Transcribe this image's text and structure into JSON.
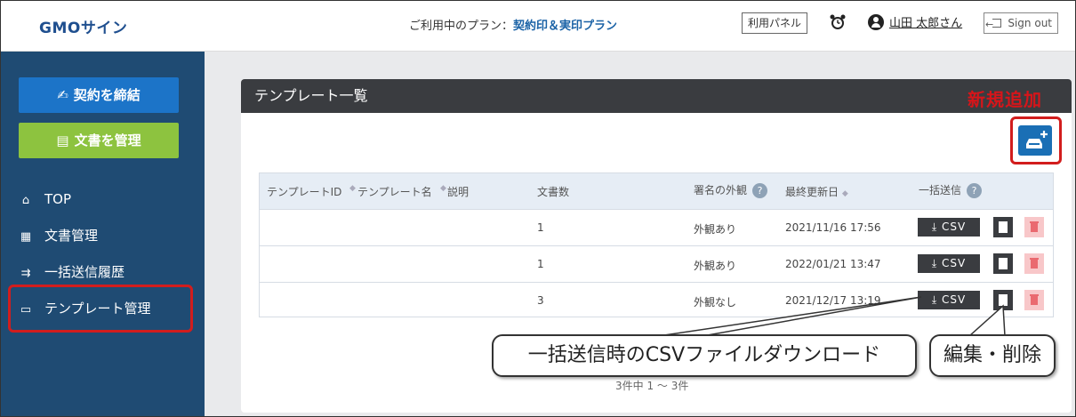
{
  "header": {
    "logo": "GMOサイン",
    "plan_label": "ご利用中のプラン：",
    "plan_name": "契約印＆実印プラン",
    "panel_button": "利用パネル",
    "user_name": "山田 太郎さん",
    "signout": "Sign out"
  },
  "sidebar": {
    "contract_button": "契約を締結",
    "docs_button": "文書を管理",
    "items": [
      {
        "label": "TOP",
        "icon": "home-icon"
      },
      {
        "label": "文書管理",
        "icon": "table-icon"
      },
      {
        "label": "一括送信履歴",
        "icon": "bulk-send-icon"
      },
      {
        "label": "テンプレート管理",
        "icon": "inbox-icon"
      }
    ]
  },
  "main": {
    "title": "テンプレート一覧",
    "new_label": "新規追加",
    "table": {
      "headers": [
        "テンプレートID",
        "テンプレート名",
        "説明",
        "文書数",
        "署名の外観",
        "最終更新日",
        "一括送信"
      ],
      "rows": [
        {
          "count": "1",
          "appearance": "外観あり",
          "updated": "2021/11/16 17:56",
          "csv": "CSV"
        },
        {
          "count": "1",
          "appearance": "外観あり",
          "updated": "2022/01/21 13:47",
          "csv": "CSV"
        },
        {
          "count": "3",
          "appearance": "外観なし",
          "updated": "2021/12/17 13:19",
          "csv": "CSV"
        }
      ]
    },
    "pager": "3件中 1 〜 3件"
  },
  "callouts": {
    "csv": "一括送信時のCSVファイルダウンロード",
    "edit": "編集・削除"
  },
  "colors": {
    "sidebar": "#1f4b73",
    "contract_button": "#1c74c8",
    "docs_button": "#8dc33f",
    "highlight": "#d21d1d"
  }
}
